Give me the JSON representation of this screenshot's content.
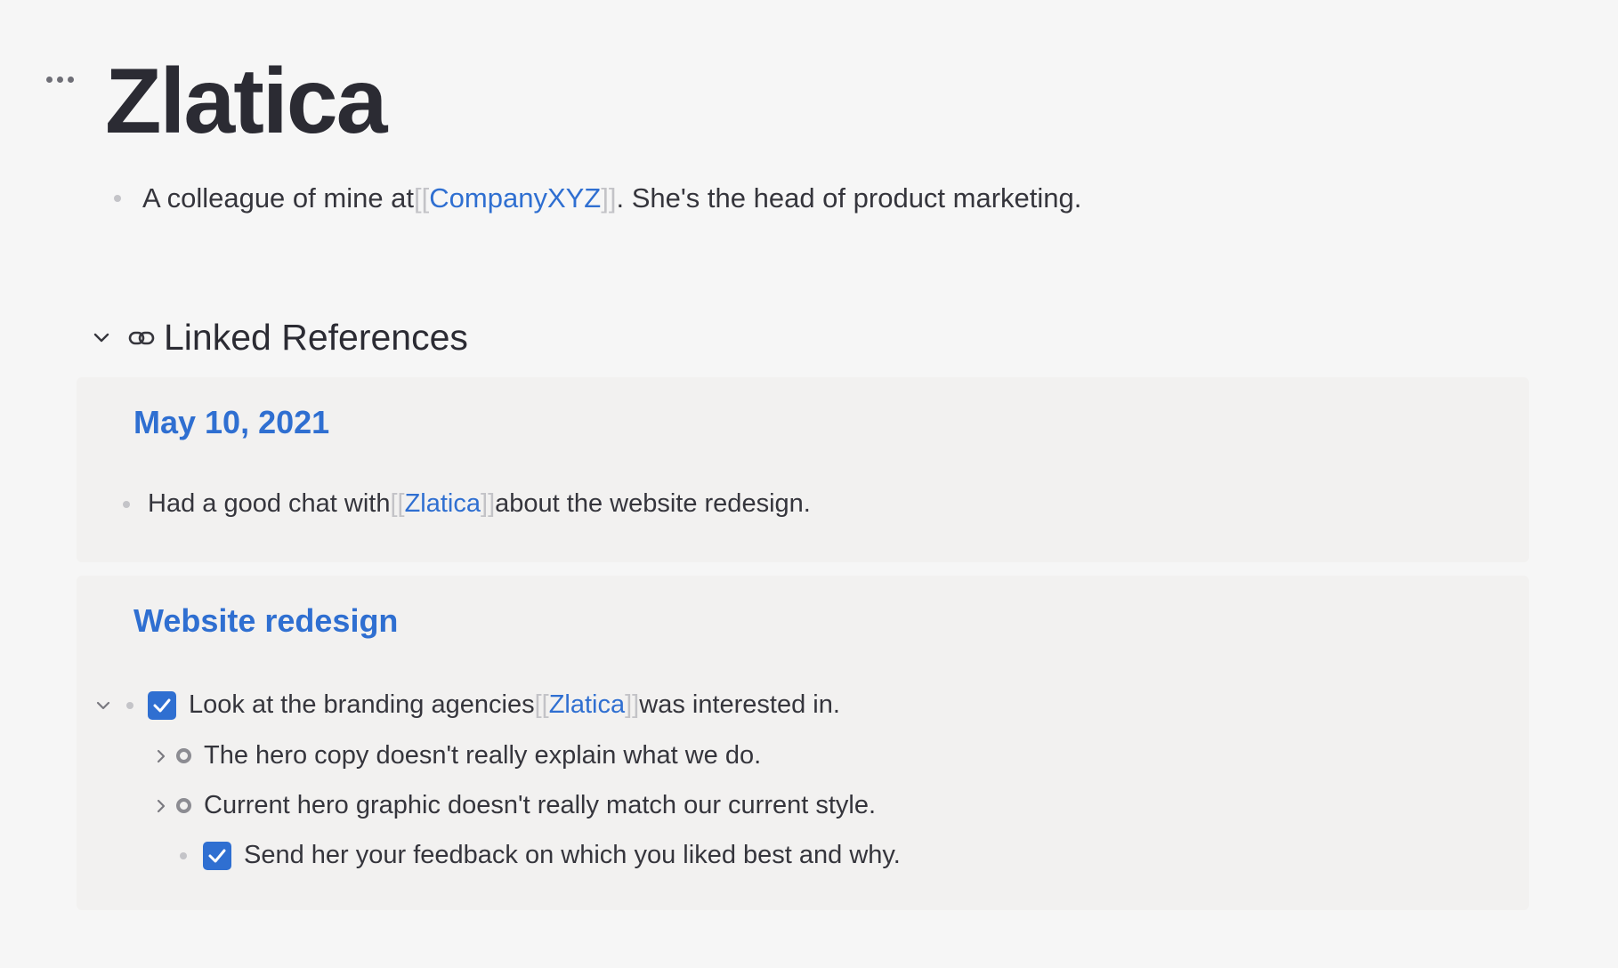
{
  "page": {
    "title": "Zlatica",
    "menu_icon": "more-horizontal-icon",
    "blocks": [
      {
        "before": "A colleague of mine at ",
        "ref_open": "[[",
        "ref": "CompanyXYZ",
        "ref_close": "]]",
        "after": ". She's the head of product marketing."
      }
    ]
  },
  "linked_references": {
    "title": "Linked References",
    "collapse_icon": "chevron-down-icon",
    "icon": "link-icon",
    "groups": [
      {
        "page_title": "May 10, 2021",
        "blocks": [
          {
            "before": "Had a good chat with ",
            "ref_open": "[[",
            "ref": "Zlatica",
            "ref_close": "]]",
            "after": " about the website redesign."
          }
        ]
      },
      {
        "page_title": "Website redesign",
        "blocks": [
          {
            "checked": true,
            "before": "Look at the branding agencies ",
            "ref_open": "[[",
            "ref": "Zlatica",
            "ref_close": "]]",
            "after": " was interested in.",
            "expanded": true
          },
          {
            "text": "The hero copy doesn't really explain what we do.",
            "collapsed": true
          },
          {
            "text": "Current hero graphic doesn't really match our current style.",
            "collapsed": true
          },
          {
            "checked": true,
            "text": "Send her your feedback on which you liked best and why."
          }
        ]
      }
    ]
  },
  "colors": {
    "background": "#f6f6f6",
    "card": "#f2f1f0",
    "link": "#2f6fd1",
    "text": "#35353c",
    "bracket": "#c3c3c7",
    "checkbox": "#2f6fd1"
  }
}
